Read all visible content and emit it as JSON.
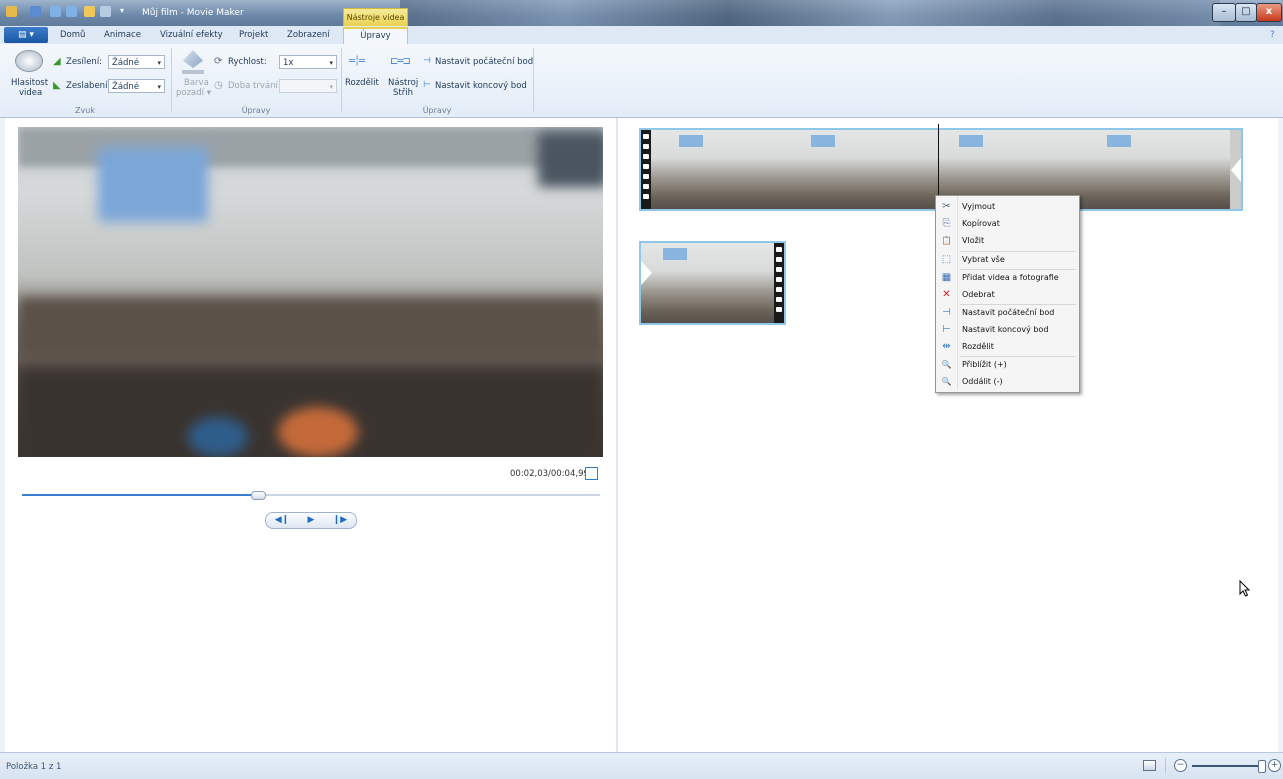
{
  "window": {
    "title": "Můj film - Movie Maker",
    "contextual_tab_caption": "Nástroje videa",
    "minimize": "–",
    "maximize": "□",
    "close": "x"
  },
  "tabs": {
    "app_menu": "▤ ▾",
    "items": [
      "Domů",
      "Animace",
      "Vizuální efekty",
      "Projekt",
      "Zobrazení"
    ],
    "active": "Úpravy"
  },
  "ribbon": {
    "audio": {
      "volume_label_1": "Hlasitost",
      "volume_label_2": "videa",
      "fade_in_label": "Zesílení:",
      "fade_in_value": "Žádné",
      "fade_out_label": "Zeslabení:",
      "fade_out_value": "Žádné",
      "group_label": "Zvuk"
    },
    "edit": {
      "bg_color_label_1": "Barva",
      "bg_color_label_2": "pozadí ▾",
      "speed_label": "Rychlost:",
      "speed_value": "1x",
      "duration_label": "Doba trvání:",
      "duration_value": "",
      "group_label": "Úpravy"
    },
    "split_trim": {
      "split_label": "Rozdělit",
      "trim_label_1": "Nástroj",
      "trim_label_2": "Střih",
      "set_start_label": "Nastavit počáteční bod",
      "set_end_label": "Nastavit koncový bod",
      "group_label": "Úpravy"
    }
  },
  "preview": {
    "time": "00:02,03/00:04,99",
    "seek_progress_pct": 40.8,
    "prev_frame": "◀❙",
    "play": "▶",
    "next_frame": "❙▶"
  },
  "context_menu": {
    "items": [
      {
        "label": "Vyjmout",
        "icon": "cut-icon",
        "glyph": "✂"
      },
      {
        "label": "Kopírovat",
        "icon": "copy-icon",
        "glyph": "⎘"
      },
      {
        "label": "Vložit",
        "icon": "paste-icon",
        "glyph": "📋"
      },
      {
        "label": "Vybrat vše",
        "icon": "select-all-icon",
        "glyph": "⬚"
      },
      {
        "label": "Přidat videa a fotografie",
        "icon": "add-media-icon",
        "glyph": "▦"
      },
      {
        "label": "Odebrat",
        "icon": "remove-icon",
        "glyph": "✕"
      },
      {
        "label": "Nastavit počáteční bod",
        "icon": "set-start-icon",
        "glyph": "⊣"
      },
      {
        "label": "Nastavit koncový bod",
        "icon": "set-end-icon",
        "glyph": "⊢"
      },
      {
        "label": "Rozdělit",
        "icon": "split-icon",
        "glyph": "⇹"
      },
      {
        "label": "Přiblížit (+)",
        "icon": "zoom-in-icon",
        "glyph": "🔍"
      },
      {
        "label": "Oddálit (-)",
        "icon": "zoom-out-icon",
        "glyph": "🔍"
      }
    ]
  },
  "statusbar": {
    "text": "Položka 1 z 1",
    "zoom_out": "−",
    "zoom_in": "+"
  },
  "colors": {
    "accent": "#3a7fd0",
    "clip_border": "#8fc7e9",
    "contextual_tab": "#e9d14f"
  }
}
